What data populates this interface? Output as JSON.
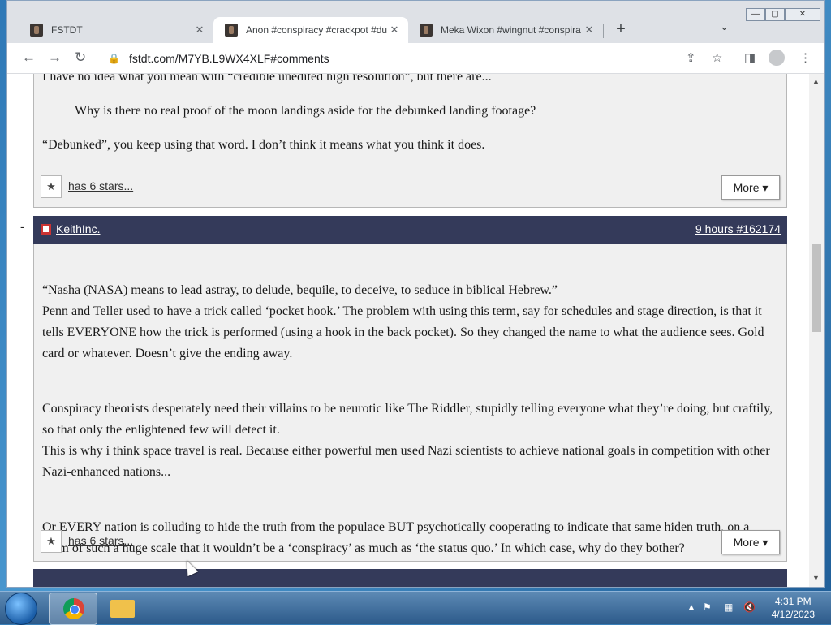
{
  "tabs": [
    {
      "title": "FSTDT",
      "close": "✕"
    },
    {
      "title": "Anon #conspiracy #crackpot #du",
      "close": "✕"
    },
    {
      "title": "Meka Wixon #wingnut #conspira",
      "close": "✕"
    }
  ],
  "new_tab": "+",
  "tab_search": "⌄",
  "window_controls": {
    "minimize": "—",
    "maximize": "▢",
    "close": "✕"
  },
  "nav": {
    "back": "←",
    "forward": "→",
    "reload": "↻"
  },
  "address": {
    "url": "fstdt.com/M7YB.L9WX4XLF#comments"
  },
  "toolbar_icons": {
    "share": "⇪",
    "bookmark": "☆",
    "sidepanel": "◨",
    "menu": "⋮"
  },
  "post1": {
    "paragraphs": [
      "I have no idea what you mean with “credible unedited high resolution”, but there are...",
      "“Debunked”, you keep using that word. I don’t think it means what you think it does."
    ],
    "quote": "Why is there no real proof of the moon landings aside for the debunked landing footage?",
    "stars": "has 6 stars...",
    "more": "More ▾"
  },
  "post2": {
    "collapse": "-",
    "author": "KeithInc.",
    "meta": "9 hours #162174",
    "paragraphs": [
      "“Nasha (NASA) means to lead astray, to delude, bequile, to deceive, to seduce in biblical Hebrew.”\nPenn and Teller used to have a trick called ‘pocket hook.’ The problem with using this term, say for schedules and stage direction, is that it tells EVERYONE how the trick is performed (using a hook in the back pocket). So they changed the name to what the audience sees. Gold card or whatever. Doesn’t give the ending away.",
      "Conspiracy theorists desperately need their villains to be neurotic like The Riddler, stupidly telling everyone what they’re doing, but craftily, so that only the enlightened few will detect it.\nThis is why i think space travel is real. Because either powerful men used Nazi scientists to achieve national goals in competition with other Nazi-enhanced nations...",
      "Or EVERY nation is colluding to hide the truth from the populace BUT psychotically cooperating to indicate that same hiden truth, on a scam of such a huge scale that it wouldn’t be a ‘conspiracy’ as much as ‘the status quo.’ In which case, why do they bother?"
    ],
    "stars": "has 6 stars...",
    "more": "More ▾"
  },
  "star_glyph": "★",
  "taskbar": {
    "time": "4:31 PM",
    "date": "4/12/2023"
  }
}
